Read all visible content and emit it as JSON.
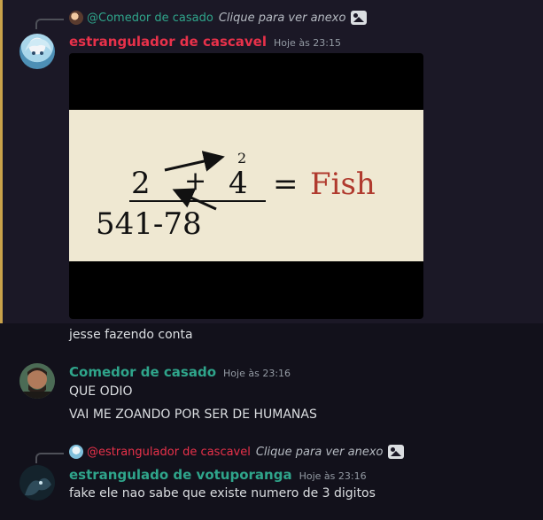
{
  "messages": [
    {
      "reply": {
        "name": "@Comedor de casado",
        "link": "Clique para ver anexo",
        "name_color": "#2fa58b"
      },
      "author": "estrangulador de cascavel",
      "author_color": "#e8314a",
      "time": "Hoje às 23:15",
      "attachment": {
        "numerator": [
          "2",
          "+",
          "4"
        ],
        "superscript": "2",
        "denominator": "541-78",
        "equals": "=",
        "result": "Fish",
        "result_color": "#b03a2e"
      },
      "text": "jesse fazendo conta"
    },
    {
      "author": "Comedor de casado",
      "author_color": "#2fa58b",
      "time": "Hoje às 23:16",
      "lines": [
        "QUE ODIO",
        "VAI ME ZOANDO POR SER DE HUMANAS"
      ]
    },
    {
      "reply": {
        "name": "@estrangulador de cascavel",
        "link": "Clique para ver anexo",
        "name_color": "#e8314a"
      },
      "author": "estrangulado de votuporanga",
      "author_color": "#2fa58b",
      "time": "Hoje às 23:16",
      "text": "fake ele nao sabe que existe numero de 3 digitos"
    }
  ]
}
